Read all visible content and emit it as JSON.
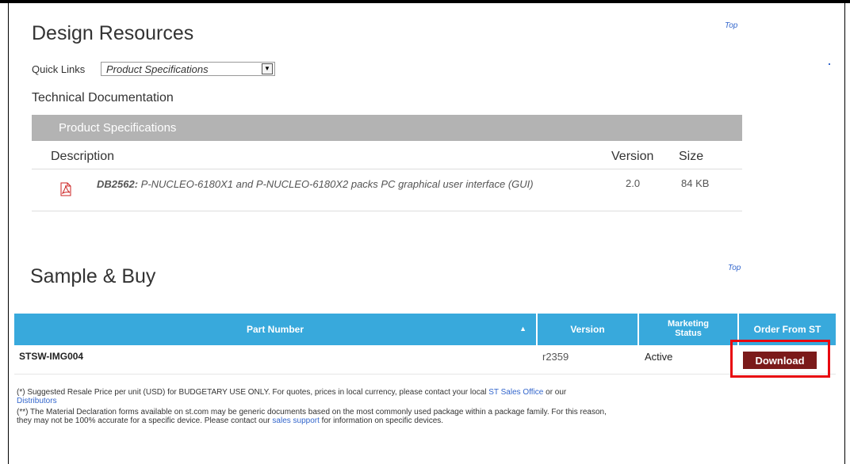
{
  "top_link": "Top",
  "design_resources": {
    "title": "Design Resources",
    "quick_links_label": "Quick Links",
    "quick_links_selected": "Product Specifications",
    "tech_doc_label": "Technical Documentation",
    "section_header": "Product Specifications",
    "columns": {
      "description": "Description",
      "version": "Version",
      "size": "Size"
    },
    "doc": {
      "id": "DB2562:",
      "title": "P-NUCLEO-6180X1 and P-NUCLEO-6180X2 packs PC graphical user interface (GUI)",
      "version": "2.0",
      "size": "84 KB",
      "icon": "pdf-icon"
    }
  },
  "sample_buy": {
    "title": "Sample & Buy",
    "columns": {
      "part_number": "Part Number",
      "version": "Version",
      "marketing_status_1": "Marketing",
      "marketing_status_2": "Status",
      "order": "Order From ST"
    },
    "row": {
      "part_number": "STSW-IMG004",
      "version": "r2359",
      "status": "Active",
      "order_button": "Download"
    }
  },
  "footnotes": {
    "line1_pre": "(*) Suggested Resale Price per unit (USD) for BUDGETARY USE ONLY. For quotes, prices in local currency, please contact your local ",
    "line1_link1": "ST Sales Office",
    "line1_mid": " or our",
    "line1_link2": "Distributors",
    "line2_pre": "(**) The Material Declaration forms available on st.com may be generic documents based on the most commonly used package within a package family. For this reason,",
    "line3_pre": "they may not be 100% accurate for a specific device. Please contact our ",
    "line3_link": "sales support",
    "line3_post": " for information on specific devices."
  },
  "colors": {
    "accent_header": "#38a9dc",
    "download_button": "#7b1a1a",
    "highlight_box": "#e8090f"
  }
}
